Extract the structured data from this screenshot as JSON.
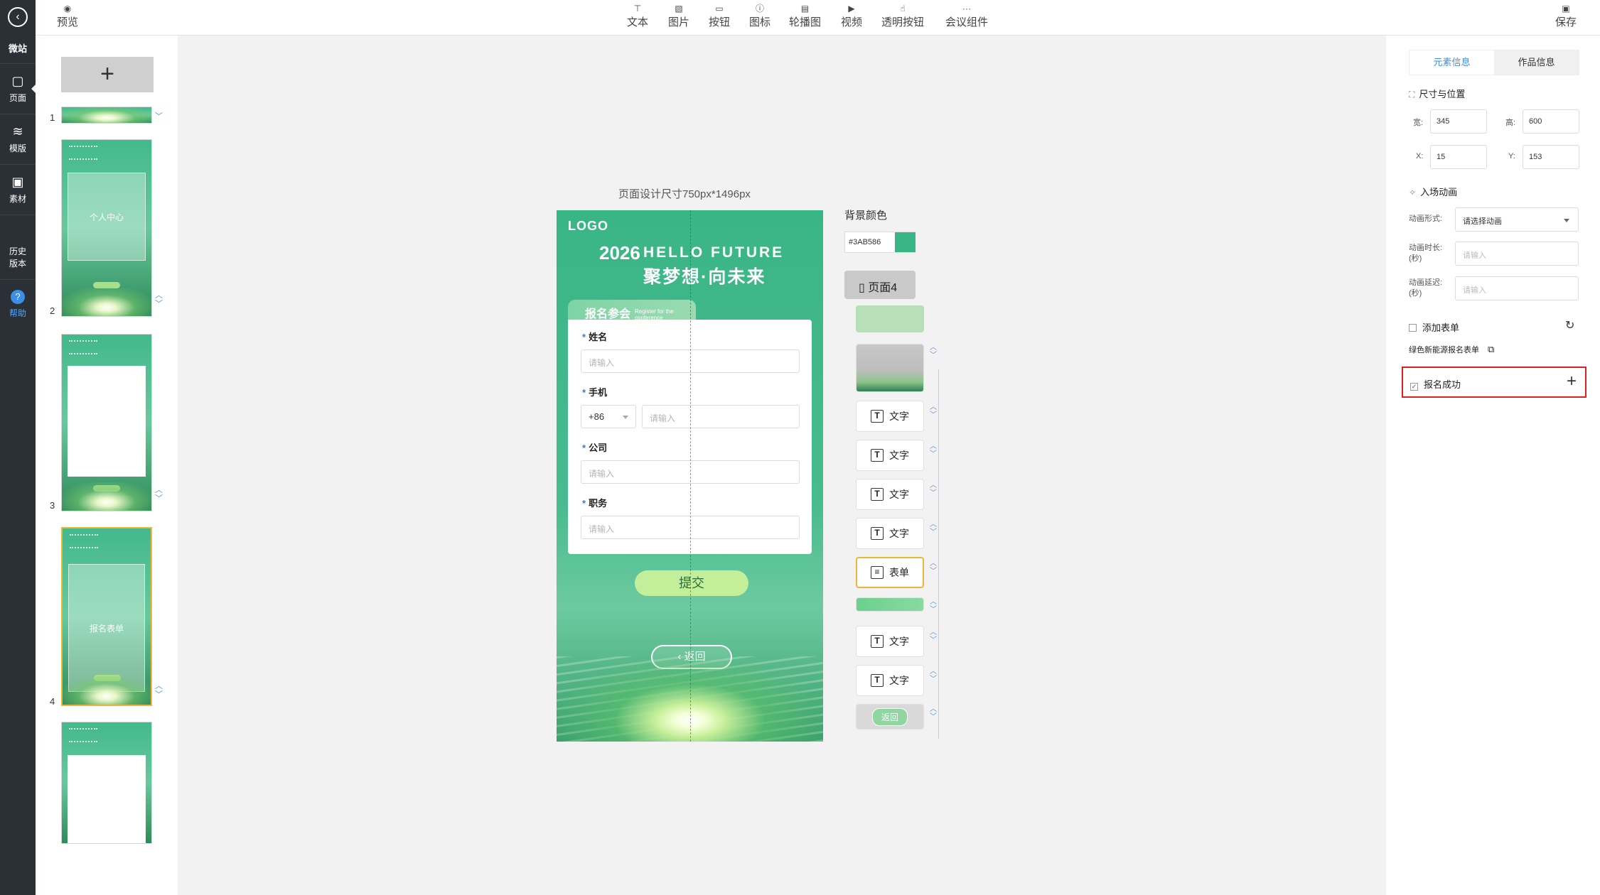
{
  "leftnav": {
    "brand": "微站",
    "items": [
      {
        "icon": "page-icon",
        "glyph": "▢",
        "label": "页面"
      },
      {
        "icon": "layers-icon",
        "glyph": "≋",
        "label": "模版"
      },
      {
        "icon": "image-icon",
        "glyph": "▣",
        "label": "素材"
      },
      {
        "icon": "history-icon",
        "glyph": "",
        "label": "历史\n版本"
      },
      {
        "icon": "help-icon",
        "glyph": "?",
        "label": "帮助"
      }
    ]
  },
  "topbar": {
    "preview": "预览",
    "tools": [
      "文本",
      "图片",
      "按钮",
      "图标",
      "轮播图",
      "视频",
      "透明按钮",
      "会议组件"
    ],
    "save": "保存"
  },
  "pages": {
    "add_glyph": "+",
    "numbers": [
      "1",
      "2",
      "3",
      "4"
    ],
    "thumb_labels": [
      "个人中心",
      "报名表单"
    ]
  },
  "canvas": {
    "size_label": "页面设计尺寸750px*1496px",
    "logo": "LOGO",
    "year": "2026",
    "hello": "HELLO FUTURE",
    "slogan": "聚梦想·向未来",
    "reg_title": "报名参会",
    "reg_sub": "Register for the conference",
    "fields": [
      {
        "label": "姓名",
        "placeholder": "请输入"
      },
      {
        "label": "手机",
        "code": "+86",
        "placeholder": "请输入"
      },
      {
        "label": "公司",
        "placeholder": "请输入"
      },
      {
        "label": "职务",
        "placeholder": "请输入"
      }
    ],
    "submit": "提交",
    "back": "返回"
  },
  "layers": {
    "bg_label": "背景颜色",
    "bg_color": "#3AB586",
    "page_badge": "页面4",
    "text_label": "文字",
    "form_label": "表单",
    "back_label": "返回"
  },
  "props": {
    "tab_element": "元素信息",
    "tab_work": "作品信息",
    "size_section": "尺寸与位置",
    "w_label": "宽:",
    "w": "345",
    "h_label": "高:",
    "h": "600",
    "x_label": "X:",
    "x": "15",
    "y_label": "Y:",
    "y": "153",
    "anim_section": "入场动画",
    "anim_type_label": "动画形式:",
    "anim_type_value": "请选择动画",
    "anim_dur_label": "动画时长:\n(秒)",
    "anim_delay_label": "动画延迟:\n(秒)",
    "placeholder": "请输入",
    "add_form": "添加表单",
    "form_name": "绿色新能源报名表单",
    "success": "报名成功"
  },
  "colors": {
    "accent": "#3a8ee6",
    "brand_green": "#3AB586",
    "highlight": "#e02020",
    "selected": "#f0b43c"
  }
}
